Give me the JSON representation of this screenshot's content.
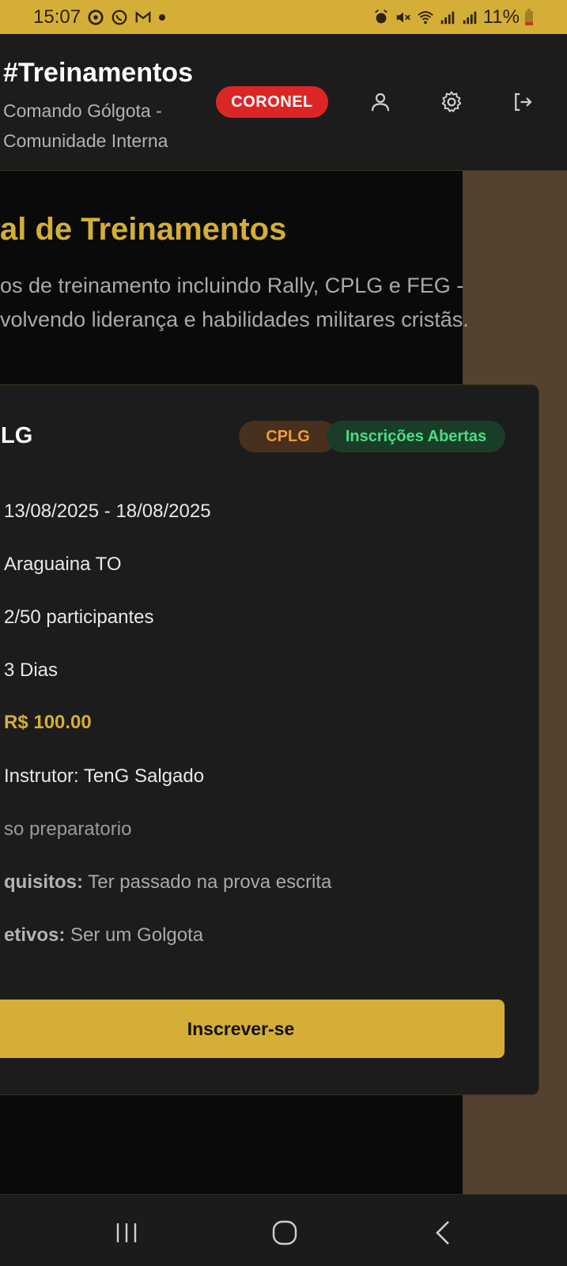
{
  "status_bar": {
    "time": "15:07",
    "battery": "11%",
    "icons": [
      "chrome-icon",
      "whatsapp-icon",
      "gmail-icon",
      "dot-icon",
      "alarm-icon",
      "mute-icon",
      "wifi-icon",
      "signal-icon",
      "signal-icon",
      "battery-icon"
    ]
  },
  "header": {
    "title": "#Treinamentos",
    "subtitle": "Comando Gólgota - Comunidade Interna",
    "rank_badge": "CORONEL",
    "icons": [
      "user-icon",
      "gear-icon",
      "logout-icon"
    ],
    "badge_color": "#dc2626"
  },
  "page": {
    "title": "al de Treinamentos",
    "description_lines": [
      "os de treinamento incluindo Rally, CPLG e FEG -",
      "volvendo liderança e habilidades militares cristãs."
    ]
  },
  "card": {
    "title": "LG",
    "type_tag": "CPLG",
    "status_tag": "Inscrições Abertas",
    "dates": "13/08/2025 - 18/08/2025",
    "location": "Araguaina TO",
    "participants": "2/50 participantes",
    "duration": "3 Dias",
    "price": "R$ 100.00",
    "instructor": "Instrutor: TenG Salgado",
    "description": "so preparatorio",
    "requirements_label": "quisitos:",
    "requirements_value": " Ter passado na prova escrita",
    "objectives_label": "etivos:",
    "objectives_value": " Ser um Golgota",
    "enroll_button": "Inscrever-se"
  },
  "colors": {
    "accent": "#d4ae36",
    "status_green": "#4ade80",
    "tag_orange": "#f39b3c"
  },
  "nav_bar": {
    "icons": [
      "recent-apps-icon",
      "home-icon",
      "back-icon"
    ]
  }
}
